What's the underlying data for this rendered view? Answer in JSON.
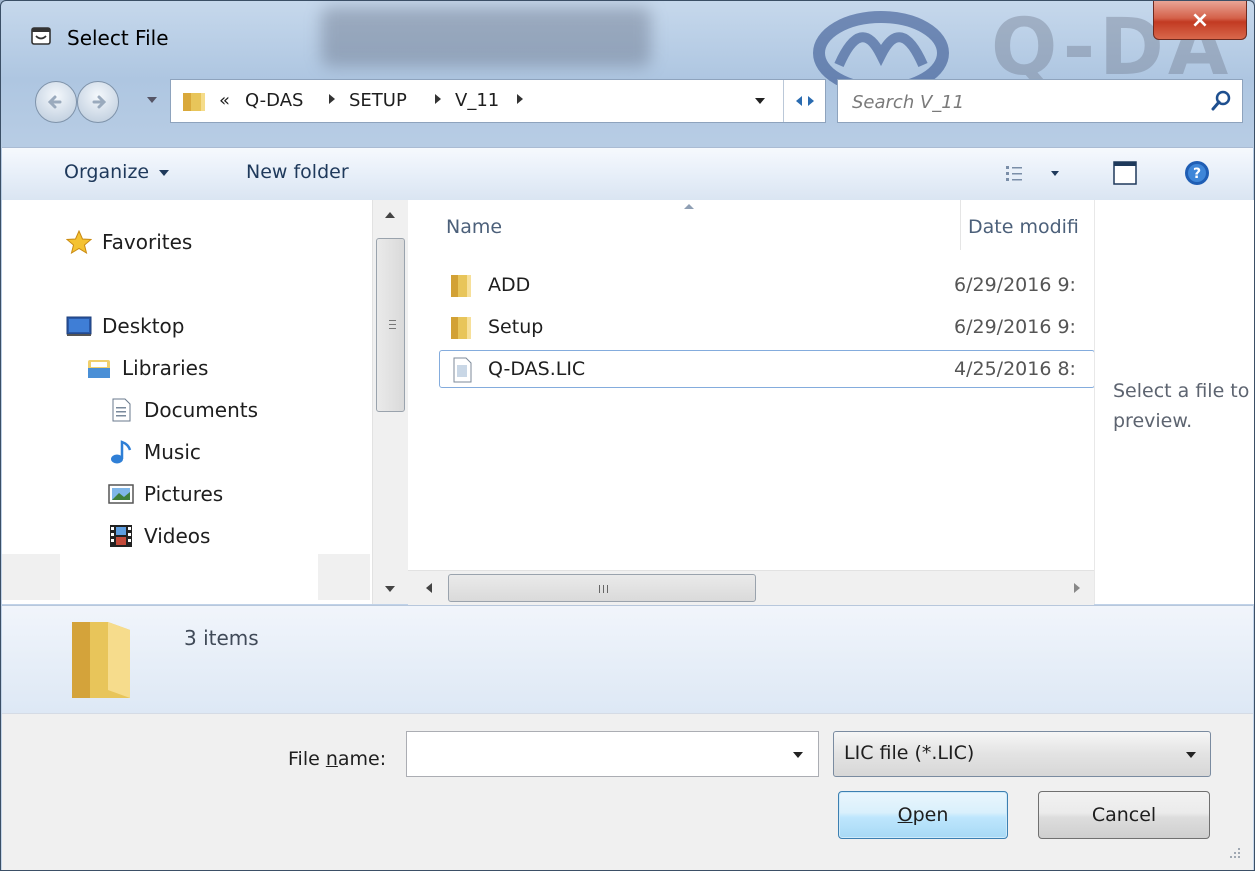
{
  "window": {
    "title": "Select File",
    "close_glyph": "×"
  },
  "background": {
    "brand_text": "Q-DA"
  },
  "address": {
    "chevron": "«",
    "crumbs": [
      "Q-DAS",
      "SETUP",
      "V_11"
    ],
    "search_placeholder": "Search V_11"
  },
  "toolbar": {
    "organize_label": "Organize",
    "new_folder_label": "New folder"
  },
  "nav": {
    "items": [
      {
        "label": "Favorites",
        "icon": "star-icon"
      },
      {
        "label": "Desktop",
        "icon": "desktop-icon"
      },
      {
        "label": "Libraries",
        "icon": "libraries-icon"
      },
      {
        "label": "Documents",
        "icon": "documents-icon"
      },
      {
        "label": "Music",
        "icon": "music-icon"
      },
      {
        "label": "Pictures",
        "icon": "pictures-icon"
      },
      {
        "label": "Videos",
        "icon": "videos-icon"
      }
    ]
  },
  "files": {
    "columns": {
      "name": "Name",
      "date": "Date modifi"
    },
    "rows": [
      {
        "name": "ADD",
        "date": "6/29/2016 9:",
        "type": "folder"
      },
      {
        "name": "Setup",
        "date": "6/29/2016 9:",
        "type": "folder"
      },
      {
        "name": "Q-DAS.LIC",
        "date": "4/25/2016 8:",
        "type": "file",
        "selected": true
      }
    ],
    "hscroll_grip": "III"
  },
  "preview": {
    "text": "Select a file to preview."
  },
  "details": {
    "count_text": "3 items"
  },
  "bottom": {
    "file_name_label_pre": "File ",
    "file_name_label_key": "n",
    "file_name_label_post": "ame:",
    "file_name_value": "",
    "file_type": "LIC file (*.LIC)",
    "open_key": "O",
    "open_rest": "pen",
    "cancel_label": "Cancel"
  },
  "colors": {
    "accent": "#3c7fb1",
    "close_red": "#c23a22",
    "toolbar_text": "#1e395b",
    "folder_yellow": "#e8c55a"
  }
}
